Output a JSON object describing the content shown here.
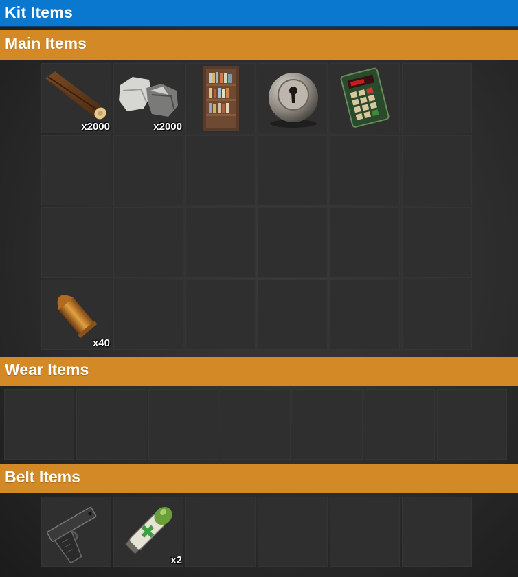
{
  "title": "Kit Items",
  "sections": {
    "main": {
      "label": "Main Items",
      "slots": [
        {
          "icon": "wood-icon",
          "qty": "x2000"
        },
        {
          "icon": "stones-icon",
          "qty": "x2000"
        },
        {
          "icon": "bookcase-icon",
          "qty": ""
        },
        {
          "icon": "lock-icon",
          "qty": ""
        },
        {
          "icon": "code-lock-icon",
          "qty": ""
        },
        {
          "icon": "",
          "qty": ""
        },
        {
          "icon": "",
          "qty": ""
        },
        {
          "icon": "",
          "qty": ""
        },
        {
          "icon": "",
          "qty": ""
        },
        {
          "icon": "",
          "qty": ""
        },
        {
          "icon": "",
          "qty": ""
        },
        {
          "icon": "",
          "qty": ""
        },
        {
          "icon": "",
          "qty": ""
        },
        {
          "icon": "",
          "qty": ""
        },
        {
          "icon": "",
          "qty": ""
        },
        {
          "icon": "",
          "qty": ""
        },
        {
          "icon": "",
          "qty": ""
        },
        {
          "icon": "",
          "qty": ""
        },
        {
          "icon": "pistol-bullet-icon",
          "qty": "x40"
        },
        {
          "icon": "",
          "qty": ""
        },
        {
          "icon": "",
          "qty": ""
        },
        {
          "icon": "",
          "qty": ""
        },
        {
          "icon": "",
          "qty": ""
        },
        {
          "icon": "",
          "qty": ""
        }
      ]
    },
    "wear": {
      "label": "Wear Items",
      "slots": [
        {
          "icon": "",
          "qty": ""
        },
        {
          "icon": "",
          "qty": ""
        },
        {
          "icon": "",
          "qty": ""
        },
        {
          "icon": "",
          "qty": ""
        },
        {
          "icon": "",
          "qty": ""
        },
        {
          "icon": "",
          "qty": ""
        },
        {
          "icon": "",
          "qty": ""
        }
      ]
    },
    "belt": {
      "label": "Belt Items",
      "slots": [
        {
          "icon": "pistol-icon",
          "qty": ""
        },
        {
          "icon": "medical-syringe-icon",
          "qty": "x2"
        },
        {
          "icon": "",
          "qty": ""
        },
        {
          "icon": "",
          "qty": ""
        },
        {
          "icon": "",
          "qty": ""
        },
        {
          "icon": "",
          "qty": ""
        }
      ]
    }
  }
}
